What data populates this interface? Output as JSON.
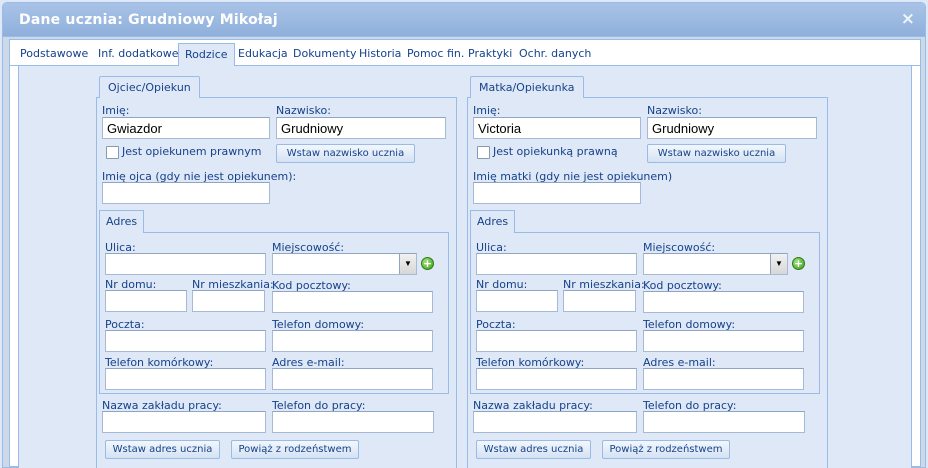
{
  "window": {
    "title": "Dane ucznia: Grudniowy Mikołaj",
    "close_symbol": "×"
  },
  "tabs": [
    {
      "label": "Podstawowe"
    },
    {
      "label": "Inf. dodatkowe"
    },
    {
      "label": "Rodzice",
      "active": true
    },
    {
      "label": "Edukacja"
    },
    {
      "label": "Dokumenty"
    },
    {
      "label": "Historia"
    },
    {
      "label": "Pomoc fin."
    },
    {
      "label": "Praktyki"
    },
    {
      "label": "Ochr. danych"
    }
  ],
  "father": {
    "tab_label": "Ojciec/Opiekun",
    "first_name_label": "Imię:",
    "first_name_value": "Gwiazdor",
    "last_name_label": "Nazwisko:",
    "last_name_value": "Grudniowy",
    "guardian_checkbox_label": "Jest opiekunem prawnym",
    "guardian_checked": false,
    "insert_surname_button": "Wstaw nazwisko ucznia",
    "parent_name_label": "Imię ojca (gdy nie jest opiekunem):",
    "parent_name_value": "",
    "address": {
      "tab_label": "Adres",
      "street_label": "Ulica:",
      "street_value": "",
      "city_label": "Miejscowość:",
      "city_value": "",
      "house_no_label": "Nr domu:",
      "house_no_value": "",
      "flat_no_label": "Nr mieszkania:",
      "flat_no_value": "",
      "postal_code_label": "Kod pocztowy:",
      "postal_code_value": "",
      "post_office_label": "Poczta:",
      "post_office_value": "",
      "home_phone_label": "Telefon domowy:",
      "home_phone_value": "",
      "mobile_phone_label": "Telefon komórkowy:",
      "mobile_phone_value": "",
      "email_label": "Adres e-mail:",
      "email_value": ""
    },
    "workplace_label": "Nazwa zakładu pracy:",
    "workplace_value": "",
    "work_phone_label": "Telefon do pracy:",
    "work_phone_value": "",
    "insert_address_button": "Wstaw adres ucznia",
    "link_sibling_button": "Powiąż z rodzeństwem"
  },
  "mother": {
    "tab_label": "Matka/Opiekunka",
    "first_name_label": "Imię:",
    "first_name_value": "Victoria",
    "last_name_label": "Nazwisko:",
    "last_name_value": "Grudniowy",
    "guardian_checkbox_label": "Jest opiekunką prawną",
    "guardian_checked": false,
    "insert_surname_button": "Wstaw nazwisko ucznia",
    "parent_name_label": "Imię matki (gdy nie jest opiekunem)",
    "parent_name_value": "",
    "address": {
      "tab_label": "Adres",
      "street_label": "Ulica:",
      "street_value": "",
      "city_label": "Miejscowość:",
      "city_value": "",
      "house_no_label": "Nr domu:",
      "house_no_value": "",
      "flat_no_label": "Nr mieszkania:",
      "flat_no_value": "",
      "postal_code_label": "Kod pocztowy:",
      "postal_code_value": "",
      "post_office_label": "Poczta:",
      "post_office_value": "",
      "home_phone_label": "Telefon domowy:",
      "home_phone_value": "",
      "mobile_phone_label": "Telefon komórkowy:",
      "mobile_phone_value": "",
      "email_label": "Adres e-mail:",
      "email_value": ""
    },
    "workplace_label": "Nazwa zakładu pracy:",
    "workplace_value": "",
    "work_phone_label": "Telefon do pracy:",
    "work_phone_value": "",
    "insert_address_button": "Wstaw adres ucznia",
    "link_sibling_button": "Powiąż z rodzeństwem"
  },
  "icons": {
    "combo_arrow": "▼",
    "add": "+"
  }
}
